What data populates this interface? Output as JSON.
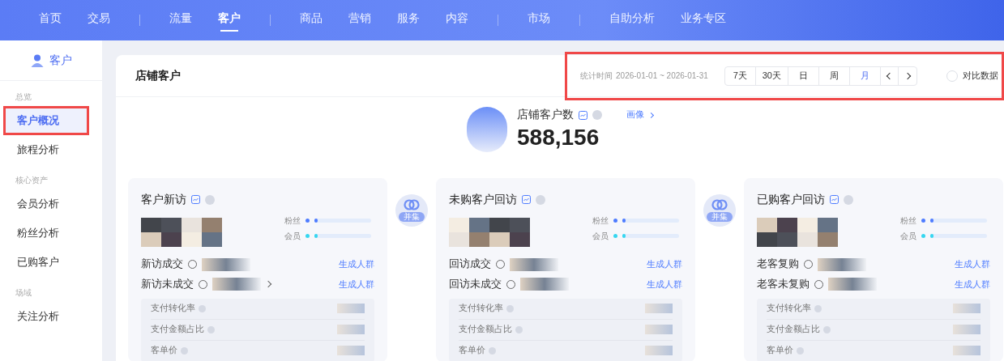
{
  "nav": {
    "groups": [
      [
        {
          "label": "首页",
          "selected": false
        },
        {
          "label": "交易",
          "selected": false
        }
      ],
      [
        {
          "label": "流量",
          "selected": false
        },
        {
          "label": "客户",
          "selected": true
        }
      ],
      [
        {
          "label": "商品",
          "selected": false
        },
        {
          "label": "营销",
          "selected": false
        },
        {
          "label": "服务",
          "selected": false
        },
        {
          "label": "内容",
          "selected": false
        }
      ],
      [
        {
          "label": "市场",
          "selected": false
        }
      ],
      [
        {
          "label": "自助分析",
          "selected": false
        },
        {
          "label": "业务专区",
          "selected": false
        }
      ]
    ]
  },
  "sidebar": {
    "header": "客户",
    "sections": [
      {
        "title": "总览",
        "items": [
          {
            "label": "客户概况",
            "selected": true,
            "highlighted": true
          },
          {
            "label": "旅程分析",
            "selected": false,
            "highlighted": false
          }
        ]
      },
      {
        "title": "核心资产",
        "items": [
          {
            "label": "会员分析",
            "selected": false,
            "highlighted": false
          },
          {
            "label": "粉丝分析",
            "selected": false,
            "highlighted": false
          },
          {
            "label": "已购客户",
            "selected": false,
            "highlighted": false
          }
        ]
      },
      {
        "title": "场域",
        "items": [
          {
            "label": "关注分析",
            "selected": false,
            "highlighted": false
          }
        ]
      }
    ]
  },
  "page": {
    "title": "店铺客户",
    "toolbar": {
      "highlighted": true,
      "date_label": "统计时间",
      "date_range": "2026-01-01 ~ 2026-01-31",
      "periods": [
        {
          "label": "7天",
          "selected": false
        },
        {
          "label": "30天",
          "selected": false
        },
        {
          "label": "日",
          "selected": false
        },
        {
          "label": "周",
          "selected": false
        },
        {
          "label": "月",
          "selected": true
        }
      ],
      "compare": {
        "label": "对比数据",
        "checked": false
      }
    }
  },
  "summary": {
    "label": "店铺客户数",
    "value": "588,156",
    "link": "画像"
  },
  "unions": [
    {
      "label": "并集"
    },
    {
      "label": "并集"
    }
  ],
  "cards": [
    {
      "title": "客户新访",
      "legend": [
        {
          "label": "粉丝",
          "color": "#4e7cff",
          "level": 0.05
        },
        {
          "label": "会员",
          "color": "#36d6f0",
          "level": 0.05
        }
      ],
      "rows": [
        {
          "label": "新访成交",
          "link": "生成人群",
          "chevron": false
        },
        {
          "label": "新访未成交",
          "link": "生成人群",
          "chevron": true
        }
      ],
      "metrics": [
        "支付转化率",
        "支付金额占比",
        "客单价"
      ]
    },
    {
      "title": "未购客户回访",
      "legend": [
        {
          "label": "粉丝",
          "color": "#4e7cff",
          "level": 0.05
        },
        {
          "label": "会员",
          "color": "#36d6f0",
          "level": 0.05
        }
      ],
      "rows": [
        {
          "label": "回访成交",
          "link": "生成人群",
          "chevron": false
        },
        {
          "label": "回访未成交",
          "link": "生成人群",
          "chevron": false
        }
      ],
      "metrics": [
        "支付转化率",
        "支付金额占比",
        "客单价"
      ]
    },
    {
      "title": "已购客户回访",
      "legend": [
        {
          "label": "粉丝",
          "color": "#4e7cff",
          "level": 0.05
        },
        {
          "label": "会员",
          "color": "#36d6f0",
          "level": 0.05
        }
      ],
      "rows": [
        {
          "label": "老客复购",
          "link": "生成人群",
          "chevron": false
        },
        {
          "label": "老客未复购",
          "link": "生成人群",
          "chevron": false
        }
      ],
      "metrics": [
        "支付转化率",
        "支付金额占比",
        "客单价"
      ]
    }
  ]
}
